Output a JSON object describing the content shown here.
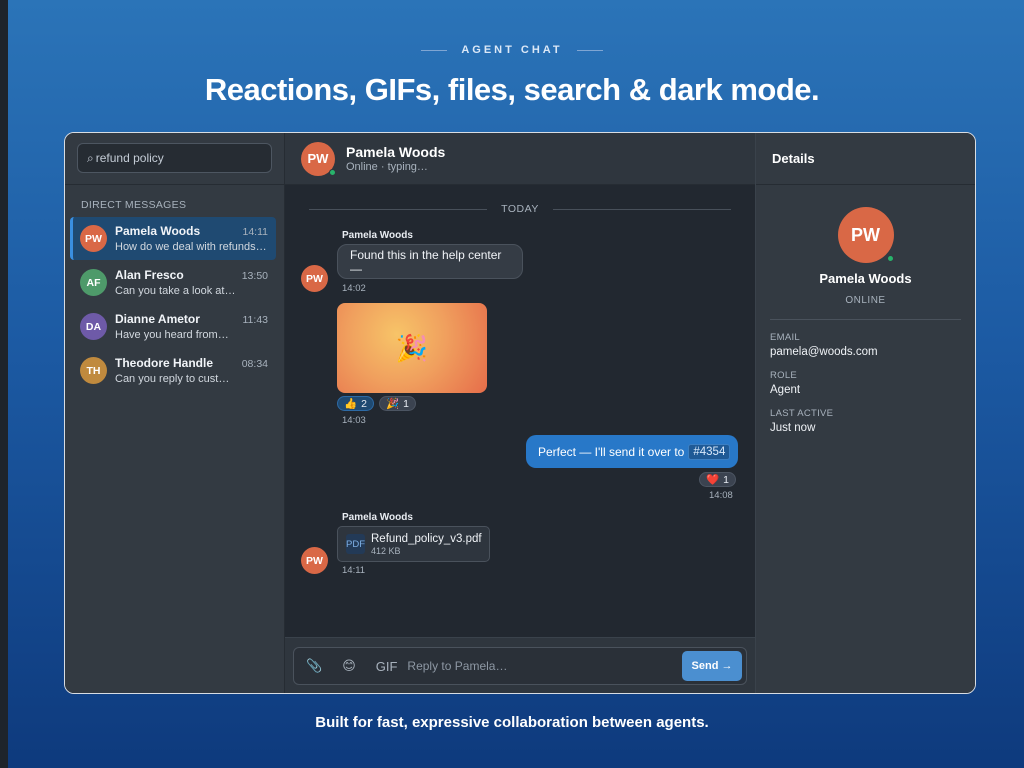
{
  "page": {
    "eyebrow": "AGENT CHAT",
    "headline": "Reactions, GIFs, files, search & dark mode.",
    "tagline": "Built for fast, expressive collaboration between agents."
  },
  "colors": {
    "accent": "#2878c8",
    "online": "#28b36b",
    "avatar_pw": "#d96846",
    "avatar_af": "#4e9a6a",
    "avatar_da": "#6e5aa8",
    "avatar_th": "#c08a3e"
  },
  "sidebar": {
    "search_icon": "⌕",
    "search_value": "refund policy",
    "section_title": "DIRECT MESSAGES",
    "contacts": [
      {
        "initials": "PW",
        "name": "Pamela Woods",
        "time": "14:11",
        "preview": "How do we deal with refunds…",
        "color": "#d96846"
      },
      {
        "initials": "AF",
        "name": "Alan Fresco",
        "time": "13:50",
        "preview": "Can you take a look at…",
        "color": "#4e9a6a"
      },
      {
        "initials": "DA",
        "name": "Dianne Ametor",
        "time": "11:43",
        "preview": "Have you heard from…",
        "color": "#6e5aa8"
      },
      {
        "initials": "TH",
        "name": "Theodore Handle",
        "time": "08:34",
        "preview": "Can you reply to cust…",
        "color": "#c08a3e"
      }
    ]
  },
  "chat": {
    "header": {
      "initials": "PW",
      "name": "Pamela Woods",
      "status": "Online · typing…"
    },
    "divider": "TODAY",
    "messages": {
      "m1_sender": "Pamela Woods",
      "m1_text": "Found this in the help center —",
      "m1_time": "14:02",
      "m2_gif_icon": "🎉",
      "m2_reaction1_emoji": "👍",
      "m2_reaction1_count": "2",
      "m2_reaction2_emoji": "🎉",
      "m2_reaction2_count": "1",
      "m2_time": "14:03",
      "m3_text": "Perfect — I'll send it over to",
      "m3_ticket": "#4354",
      "m3_reaction_emoji": "❤️",
      "m3_reaction_count": "1",
      "m3_time": "14:08",
      "m4_sender": "Pamela Woods",
      "m4_file_type": "PDF",
      "m4_file_name": "Refund_policy_v3.pdf",
      "m4_file_size": "412 KB",
      "m4_time": "14:11",
      "avatar_initials": "PW"
    },
    "composer": {
      "attach_icon": "📎",
      "emoji_icon": "😊",
      "gif_label": "GIF",
      "placeholder": "Reply to Pamela…",
      "send_label": "Send →"
    }
  },
  "details": {
    "title": "Details",
    "initials": "PW",
    "name": "Pamela Woods",
    "status": "ONLINE",
    "email_label": "EMAIL",
    "email_value": "pamela@woods.com",
    "role_label": "ROLE",
    "role_value": "Agent",
    "last_active_label": "LAST ACTIVE",
    "last_active_value": "Just now"
  }
}
